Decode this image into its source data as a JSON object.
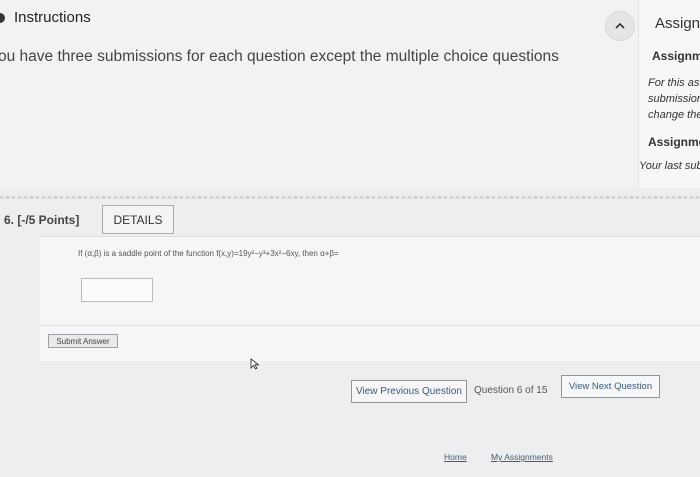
{
  "instructions": {
    "title": "Instructions",
    "text": "ou have three submissions for each question except the multiple choice questions"
  },
  "side_panel": {
    "title": "Assignr",
    "subtitle": "Assignm",
    "note_line1": "For this as:",
    "note_line2": "submission",
    "note_line3": "change the",
    "subtitle2": "Assignmen",
    "last_sub": "Your last sub"
  },
  "question": {
    "number_label": "6.  [-/5 Points]",
    "details_label": "DETAILS",
    "text": "If (α,β) is a saddle point of the function f(x,y)=19y²−y³+3x²−6xy, then α+β=",
    "answer_value": "",
    "submit_label": "Submit Answer"
  },
  "navigation": {
    "prev_label": "View Previous Question",
    "position_text": "Question 6 of 15",
    "next_label": "View Next Question"
  },
  "footer": {
    "home_label": "Home",
    "assignments_label": "My Assignments"
  },
  "icons": {
    "collapse": "chevron-up-icon",
    "cursor": "mouse-pointer-icon"
  }
}
